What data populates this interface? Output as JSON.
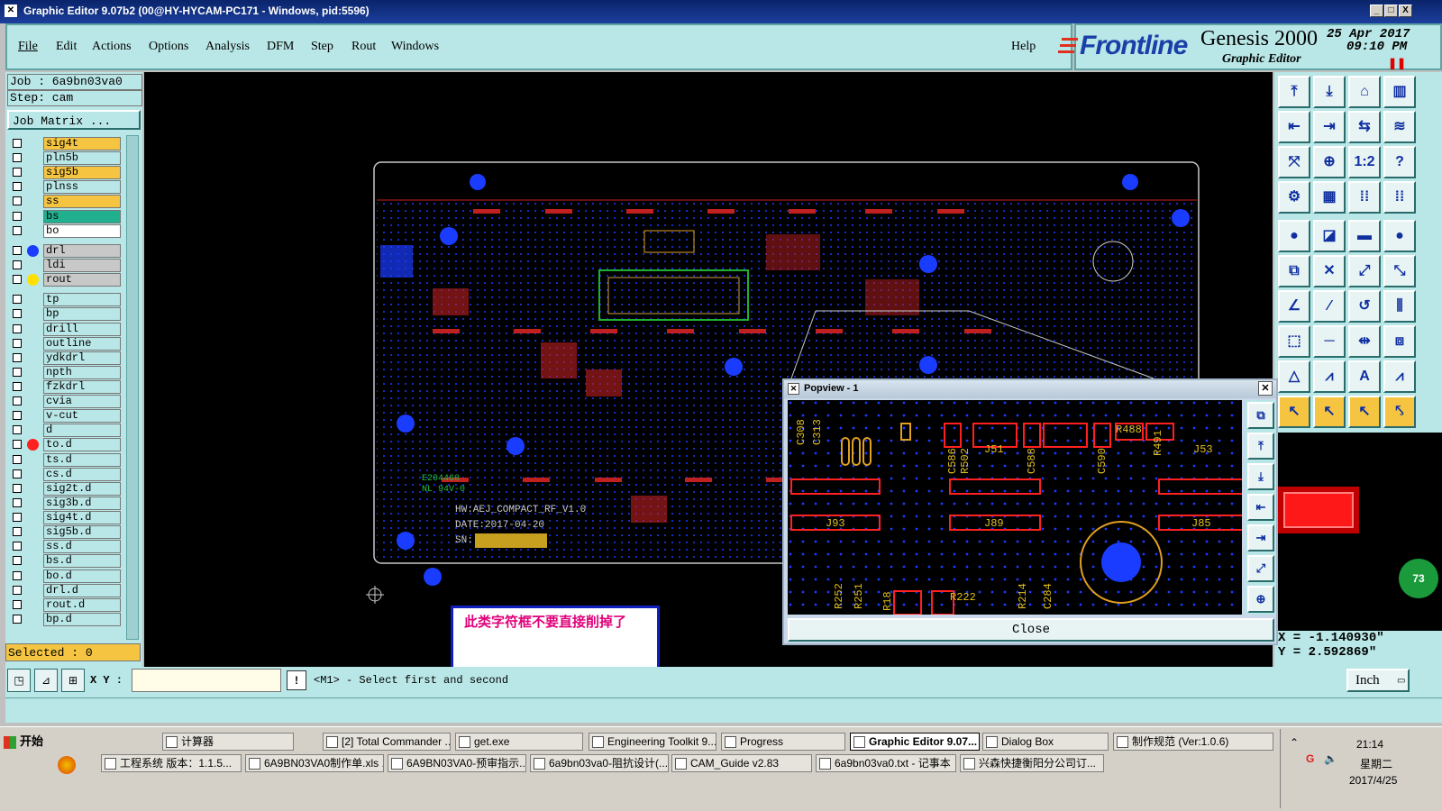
{
  "window": {
    "title": "Graphic Editor 9.07b2 (00@HY-HYCAM-PC171 - Windows, pid:5596)",
    "min": "_",
    "max": "□",
    "close": "X"
  },
  "menu": [
    "File",
    "Edit",
    "Actions",
    "Options",
    "Analysis",
    "DFM",
    "Step",
    "Rout",
    "Windows"
  ],
  "help": "Help",
  "brand": {
    "logo": "Frontline",
    "product": "Genesis 2000",
    "subtitle": "Graphic Editor",
    "date": "25 Apr 2017",
    "time": "09:10 PM"
  },
  "job": {
    "job_line": "Job : 6a9bn03va0",
    "step_line": "Step: cam",
    "matrix_button": "Job Matrix ...",
    "selected": "Selected : 0"
  },
  "layers": [
    {
      "name": "sig4t",
      "color": "#f5c542",
      "dot": ""
    },
    {
      "name": "pln5b",
      "color": "#b9e6e6",
      "dot": ""
    },
    {
      "name": "sig5b",
      "color": "#f5c542",
      "dot": ""
    },
    {
      "name": "plnss",
      "color": "#b9e6e6",
      "dot": ""
    },
    {
      "name": "ss",
      "color": "#f5c542",
      "dot": ""
    },
    {
      "name": "bs",
      "color": "#20b090",
      "dot": ""
    },
    {
      "name": "bo",
      "color": "#ffffff",
      "dot": ""
    },
    {
      "name": "drl",
      "color": "#c8c8c8",
      "dot": "#1a3cff"
    },
    {
      "name": "ldi",
      "color": "#c8c8c8",
      "dot": ""
    },
    {
      "name": "rout",
      "color": "#c8c8c8",
      "dot": "#ffe000"
    },
    {
      "name": "tp",
      "color": "#b9e6e6",
      "dot": ""
    },
    {
      "name": "bp",
      "color": "#b9e6e6",
      "dot": ""
    },
    {
      "name": "drill",
      "color": "#b9e6e6",
      "dot": ""
    },
    {
      "name": "outline",
      "color": "#b9e6e6",
      "dot": ""
    },
    {
      "name": "ydkdrl",
      "color": "#b9e6e6",
      "dot": ""
    },
    {
      "name": "npth",
      "color": "#b9e6e6",
      "dot": ""
    },
    {
      "name": "fzkdrl",
      "color": "#b9e6e6",
      "dot": ""
    },
    {
      "name": "cvia",
      "color": "#b9e6e6",
      "dot": ""
    },
    {
      "name": "v-cut",
      "color": "#b9e6e6",
      "dot": ""
    },
    {
      "name": "d",
      "color": "#b9e6e6",
      "dot": ""
    },
    {
      "name": "to.d",
      "color": "#b9e6e6",
      "dot": "#ff2020"
    },
    {
      "name": "ts.d",
      "color": "#b9e6e6",
      "dot": ""
    },
    {
      "name": "cs.d",
      "color": "#b9e6e6",
      "dot": ""
    },
    {
      "name": "sig2t.d",
      "color": "#b9e6e6",
      "dot": ""
    },
    {
      "name": "sig3b.d",
      "color": "#b9e6e6",
      "dot": ""
    },
    {
      "name": "sig4t.d",
      "color": "#b9e6e6",
      "dot": ""
    },
    {
      "name": "sig5b.d",
      "color": "#b9e6e6",
      "dot": ""
    },
    {
      "name": "ss.d",
      "color": "#b9e6e6",
      "dot": ""
    },
    {
      "name": "bs.d",
      "color": "#b9e6e6",
      "dot": ""
    },
    {
      "name": "bo.d",
      "color": "#b9e6e6",
      "dot": ""
    },
    {
      "name": "drl.d",
      "color": "#b9e6e6",
      "dot": ""
    },
    {
      "name": "rout.d",
      "color": "#b9e6e6",
      "dot": ""
    },
    {
      "name": "bp.d",
      "color": "#b9e6e6",
      "dot": ""
    }
  ],
  "board": {
    "marking1": "HW:AEJ_COMPACT_RF_V1.0",
    "marking2": "DATE:2017-04-20",
    "marking3": "SN:",
    "ul1": "E204460",
    "ul2": "NL 94V-0"
  },
  "popview": {
    "title": "Popview - 1",
    "close_label": "Close",
    "labels": [
      "C308",
      "C313",
      "C586",
      "R502",
      "J51",
      "C588",
      "C590",
      "R488",
      "R491",
      "J53",
      "J93",
      "J89",
      "J85",
      "R252",
      "R251",
      "R222",
      "R214",
      "C284",
      "R18"
    ]
  },
  "coords": {
    "x": "X = -1.140930\"",
    "y": "Y = 2.592869\""
  },
  "status": {
    "xy_label": "X Y :",
    "xy_value": "",
    "prompt": "<M1> - Select first and second",
    "units": "Inch"
  },
  "note": "此类字符框不要直接削掉了",
  "badge": "73",
  "taskbar": {
    "start": "开始",
    "row1": [
      "计算器",
      "[2] Total Commander ...",
      "get.exe",
      "Engineering Toolkit 9....",
      "Progress",
      "Graphic Editor 9.07...",
      "Dialog Box",
      "制作规范 (Ver:1.0.6)"
    ],
    "row2": [
      "工程系统  版本：1.1.5...",
      "6A9BN03VA0制作单.xls ...",
      "6A9BN03VA0-预审指示....",
      "6a9bn03va0-阻抗设计(...",
      "CAM_Guide v2.83",
      "6a9bn03va0.txt - 记事本",
      "兴森快捷衡阳分公司订..."
    ],
    "clock": "21:14",
    "weekday": "星期二",
    "date": "2017/4/25"
  }
}
